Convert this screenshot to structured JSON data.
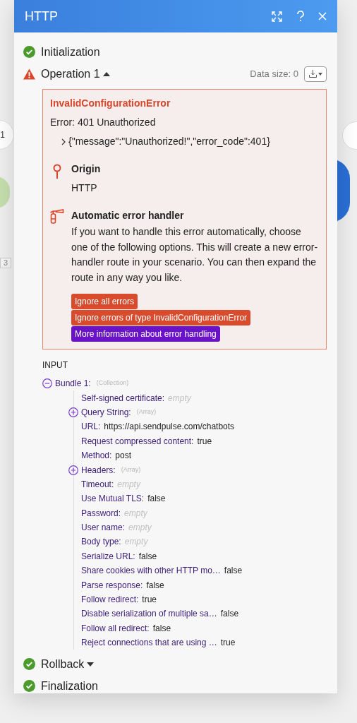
{
  "canvas": {
    "node_labels": [
      "1",
      "3"
    ]
  },
  "window": {
    "title": "HTTP"
  },
  "stages_top": [
    {
      "label": "Initialization",
      "kind": "success"
    },
    {
      "label": "Operation 1",
      "kind": "error",
      "expanded": true
    }
  ],
  "data_size": "Data size: 0",
  "error": {
    "title": "InvalidConfigurationError",
    "message": "Error: 401 Unauthorized",
    "detail": "{\"message\":\"Unauthorized!\",\"error_code\":401}",
    "origin": {
      "heading": "Origin",
      "value": "HTTP"
    },
    "handler": {
      "heading": "Automatic error handler",
      "text": "If you want to handle this error automatically, choose one of the following options. This will create a new error-handler route in your scenario. You can then expand the route in any way you like."
    },
    "actions": [
      {
        "label": "Ignore all errors",
        "kind": "danger"
      },
      {
        "label": "Ignore errors of type InvalidConfigurationError",
        "kind": "danger"
      },
      {
        "label": "More information about error handling",
        "kind": "info"
      }
    ]
  },
  "input": {
    "heading": "INPUT",
    "tree": [
      {
        "label": "Bundle 1:",
        "type": "(Collection)",
        "expanded": true,
        "children": [
          {
            "label": "Self-signed certificate:",
            "value": "empty",
            "empty": true
          },
          {
            "label": "Query String:",
            "type": "(Array)",
            "expanded": false
          },
          {
            "label": "URL:",
            "value": "https://api.sendpulse.com/chatbots",
            "empty": false
          },
          {
            "label": "Request compressed content:",
            "value": "true",
            "empty": false
          },
          {
            "label": "Method:",
            "value": "post",
            "empty": false
          },
          {
            "label": "Headers:",
            "type": "(Array)",
            "expanded": false
          },
          {
            "label": "Timeout:",
            "value": "empty",
            "empty": true
          },
          {
            "label": "Use Mutual TLS:",
            "value": "false",
            "empty": false
          },
          {
            "label": "Password:",
            "value": "empty",
            "empty": true
          },
          {
            "label": "User name:",
            "value": "empty",
            "empty": true
          },
          {
            "label": "Body type:",
            "value": "empty",
            "empty": true
          },
          {
            "label": "Serialize URL:",
            "value": "false",
            "empty": false
          },
          {
            "label": "Share cookies with other HTTP mo…",
            "value": "false",
            "empty": false
          },
          {
            "label": "Parse response:",
            "value": "false",
            "empty": false
          },
          {
            "label": "Follow redirect:",
            "value": "true",
            "empty": false
          },
          {
            "label": "Disable serialization of multiple sa…",
            "value": "false",
            "empty": false
          },
          {
            "label": "Follow all redirect:",
            "value": "false",
            "empty": false
          },
          {
            "label": "Reject connections that are using …",
            "value": "true",
            "empty": false
          }
        ]
      }
    ]
  },
  "stages_bottom": [
    {
      "label": "Rollback",
      "kind": "success",
      "expanded": false
    },
    {
      "label": "Finalization",
      "kind": "success"
    }
  ]
}
